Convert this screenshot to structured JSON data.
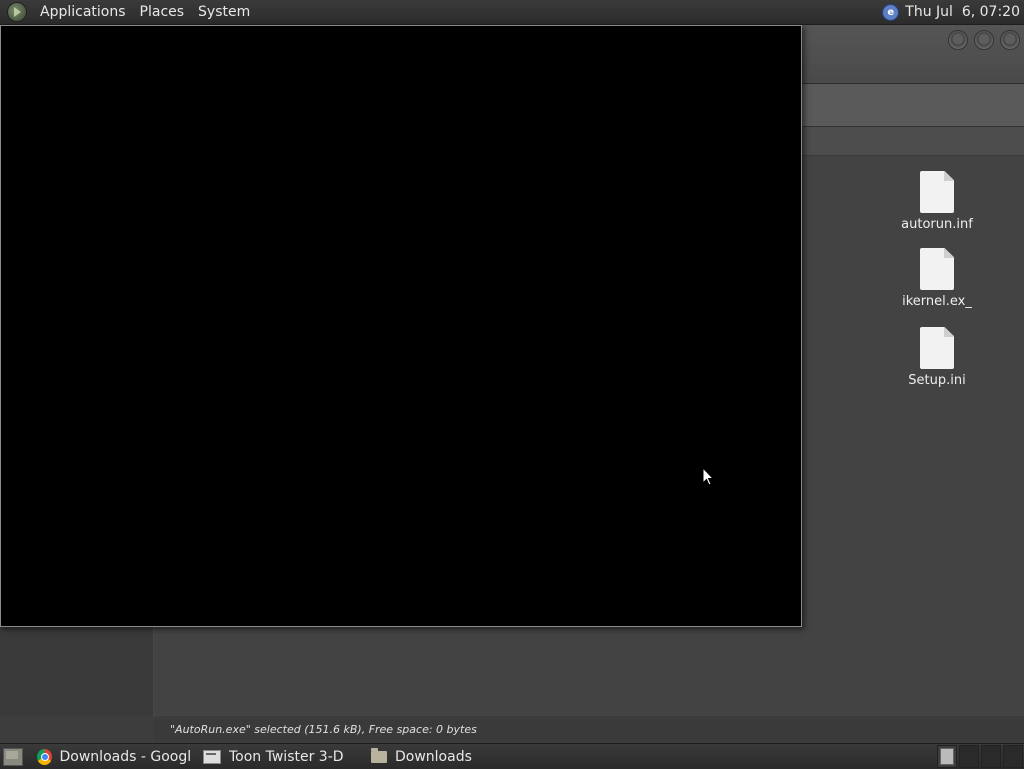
{
  "top_panel": {
    "menus": [
      "Applications",
      "Places",
      "System"
    ],
    "clock": "Thu Jul  6, 07:20"
  },
  "file_manager": {
    "files": [
      {
        "name": "autorun.inf"
      },
      {
        "name": "ikernel.ex_"
      },
      {
        "name": "Setup.ini"
      }
    ],
    "status": "\"AutoRun.exe\" selected (151.6 kB), Free space: 0 bytes"
  },
  "taskbar": {
    "tasks": [
      {
        "label": "Downloads - Googl...",
        "icon": "chrome-icon"
      },
      {
        "label": "Toon Twister 3-D",
        "icon": "terminal-icon"
      },
      {
        "label": "Downloads",
        "icon": "folder-icon"
      }
    ]
  }
}
